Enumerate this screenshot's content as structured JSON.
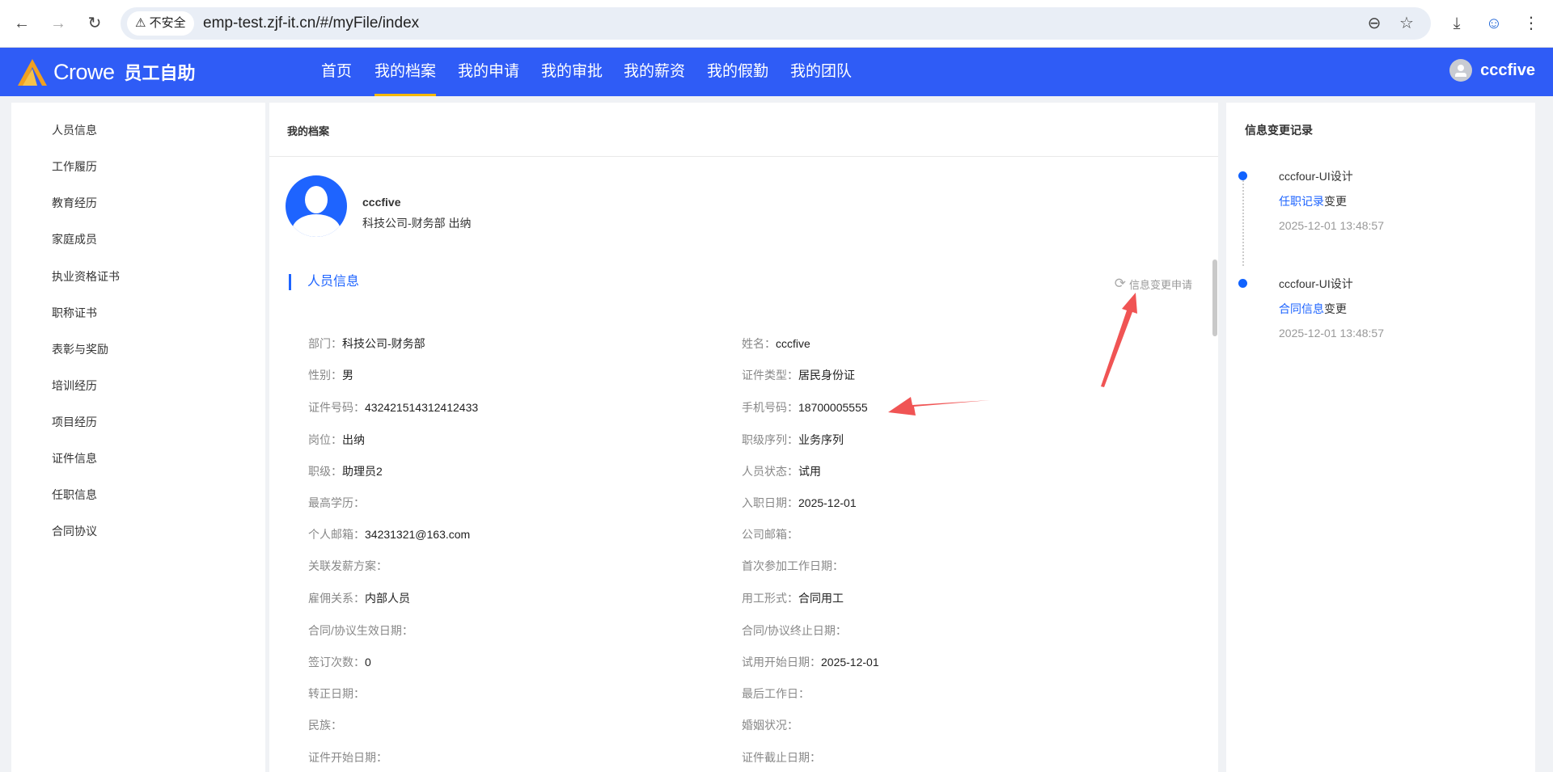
{
  "browser": {
    "security_label": "不安全",
    "url": "emp-test.zjf-it.cn/#/myFile/index"
  },
  "header": {
    "logo_text": "Crowe",
    "app_name": "员工自助",
    "nav": [
      {
        "label": "首页"
      },
      {
        "label": "我的档案",
        "active": true
      },
      {
        "label": "我的申请"
      },
      {
        "label": "我的审批"
      },
      {
        "label": "我的薪资"
      },
      {
        "label": "我的假勤"
      },
      {
        "label": "我的团队"
      }
    ],
    "user": "cccfive"
  },
  "sidebar": {
    "items": [
      "人员信息",
      "工作履历",
      "教育经历",
      "家庭成员",
      "执业资格证书",
      "职称证书",
      "表彰与奖励",
      "培训经历",
      "项目经历",
      "证件信息",
      "任职信息",
      "合同协议"
    ]
  },
  "main": {
    "title": "我的档案",
    "profile": {
      "name": "cccfive",
      "dept": "科技公司-财务部 出纳"
    },
    "section_title": "人员信息",
    "change_button": "信息变更申请",
    "fields": [
      {
        "label": "部门：",
        "value": "科技公司-财务部"
      },
      {
        "label": "姓名：",
        "value": "cccfive"
      },
      {
        "label": "性别：",
        "value": "男"
      },
      {
        "label": "证件类型：",
        "value": "居民身份证"
      },
      {
        "label": "证件号码：",
        "value": "432421514312412433"
      },
      {
        "label": "手机号码：",
        "value": "18700005555"
      },
      {
        "label": "岗位：",
        "value": "出纳"
      },
      {
        "label": "职级序列：",
        "value": "业务序列"
      },
      {
        "label": "职级：",
        "value": "助理员2"
      },
      {
        "label": "人员状态：",
        "value": "试用"
      },
      {
        "label": "最高学历：",
        "value": ""
      },
      {
        "label": "入职日期：",
        "value": "2025-12-01"
      },
      {
        "label": "个人邮箱：",
        "value": "34231321@163.com"
      },
      {
        "label": "公司邮箱：",
        "value": ""
      },
      {
        "label": "关联发薪方案：",
        "value": ""
      },
      {
        "label": "首次参加工作日期：",
        "value": ""
      },
      {
        "label": "雇佣关系：",
        "value": "内部人员"
      },
      {
        "label": "用工形式：",
        "value": "合同用工"
      },
      {
        "label": "合同/协议生效日期：",
        "value": ""
      },
      {
        "label": "合同/协议终止日期：",
        "value": ""
      },
      {
        "label": "签订次数：",
        "value": "0"
      },
      {
        "label": "试用开始日期：",
        "value": "2025-12-01"
      },
      {
        "label": "转正日期：",
        "value": ""
      },
      {
        "label": "最后工作日：",
        "value": ""
      },
      {
        "label": "民族：",
        "value": ""
      },
      {
        "label": "婚姻状况：",
        "value": ""
      },
      {
        "label": "证件开始日期：",
        "value": ""
      },
      {
        "label": "证件截止日期：",
        "value": ""
      }
    ]
  },
  "changelog": {
    "title": "信息变更记录",
    "entries": [
      {
        "user": "cccfour-UI设计",
        "link": "任职记录",
        "suffix": "变更",
        "time": "2025-12-01 13:48:57"
      },
      {
        "user": "cccfour-UI设计",
        "link": "合同信息",
        "suffix": "变更",
        "time": "2025-12-01 13:48:57"
      }
    ]
  },
  "colors": {
    "brand": "#2f5cf6",
    "accent": "#1e64ff",
    "nav_underline": "#f5b800",
    "annotation": "#f05454"
  }
}
